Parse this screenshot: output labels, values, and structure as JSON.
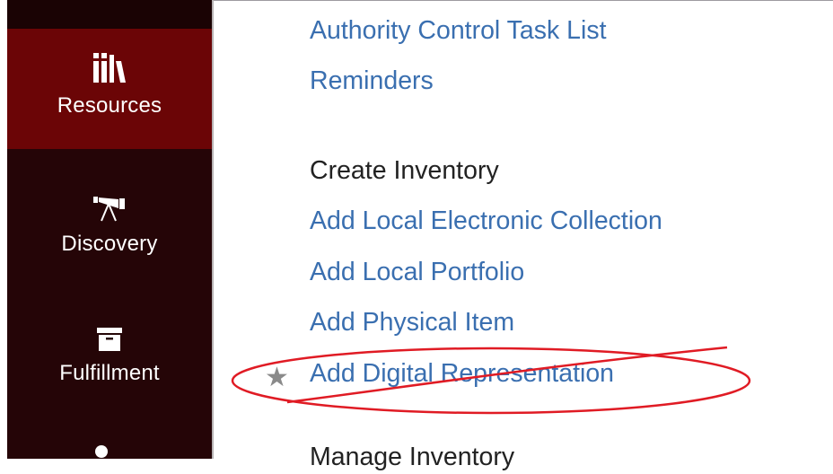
{
  "sidebar": {
    "items": [
      {
        "label": "Resources",
        "icon": "books-icon",
        "active": true
      },
      {
        "label": "Discovery",
        "icon": "telescope-icon",
        "active": false
      },
      {
        "label": "Fulfillment",
        "icon": "archive-box-icon",
        "active": false
      }
    ]
  },
  "menu": {
    "items": [
      {
        "label": "Authority Control Task List",
        "type": "link"
      },
      {
        "label": "Reminders",
        "type": "link"
      },
      {
        "label": "Create Inventory",
        "type": "heading"
      },
      {
        "label": "Add Local Electronic Collection",
        "type": "link"
      },
      {
        "label": "Add Local Portfolio",
        "type": "link"
      },
      {
        "label": "Add Physical Item",
        "type": "link"
      },
      {
        "label": "Add Digital Representation",
        "type": "link",
        "favorite": true
      },
      {
        "label": "Manage Inventory",
        "type": "heading"
      }
    ],
    "favorite_icon": "star-icon"
  },
  "annotation": {
    "shape": "ellipse-with-strike",
    "color": "#e01b24"
  },
  "colors": {
    "sidebar_bg": "#250507",
    "sidebar_active": "#6b0506",
    "link": "#3a6fb0",
    "heading": "#222222",
    "annotation": "#e01b24"
  }
}
